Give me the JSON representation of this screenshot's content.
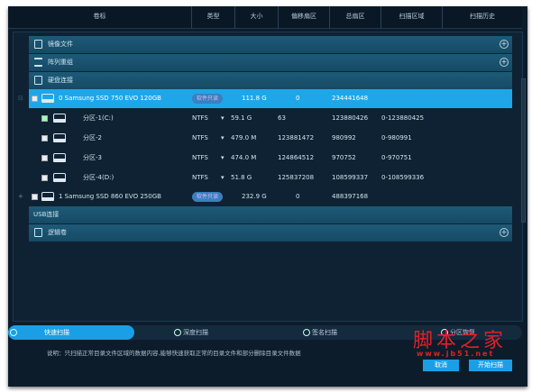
{
  "columns": [
    "卷标",
    "类型",
    "大小",
    "偏移扇区",
    "总扇区",
    "扫描区域",
    "扫描历史"
  ],
  "groups": {
    "image": "镜像文件",
    "raid": "阵列重组",
    "disk": "硬盘连接",
    "usb": "USB连接",
    "logical": "逻辑卷"
  },
  "disks": [
    {
      "expand": "⊟",
      "name": "0  Samsung SSD 750 EVO 120GB",
      "badge": "软件只读",
      "size": "111.8 G",
      "offset": "0",
      "total": "234441648"
    },
    {
      "expand": "+",
      "name": "1  Samsung SSD 860 EVO 250GB",
      "badge": "软件只读",
      "size": "232.9 G",
      "offset": "0",
      "total": "488397168"
    }
  ],
  "partitions": [
    {
      "name": "分区-1(C:)",
      "type": "NTFS",
      "size": "59.1 G",
      "offset": "63",
      "total": "123880426",
      "range": "0-123880425",
      "checked": true
    },
    {
      "name": "分区-2",
      "type": "NTFS",
      "size": "479.0 M",
      "offset": "123881472",
      "total": "980992",
      "range": "0-980991",
      "checked": false
    },
    {
      "name": "分区-3",
      "type": "NTFS",
      "size": "474.0 M",
      "offset": "124864512",
      "total": "970752",
      "range": "0-970751",
      "checked": false
    },
    {
      "name": "分区-4(D:)",
      "type": "NTFS",
      "size": "51.8 G",
      "offset": "125837208",
      "total": "108599337",
      "range": "0-108599336",
      "checked": false
    }
  ],
  "scan_modes": [
    "快速扫描",
    "深度扫描",
    "签名扫描",
    "分区恢复"
  ],
  "description": "说明：只扫描正常目录文件区域的数据内容,能够快速获取正常的目录文件和部分删除目录文件数据",
  "buttons": {
    "cancel": "取消",
    "start": "开始扫描"
  },
  "watermark": {
    "title": "脚本之家",
    "url": "www.jb51.net"
  }
}
